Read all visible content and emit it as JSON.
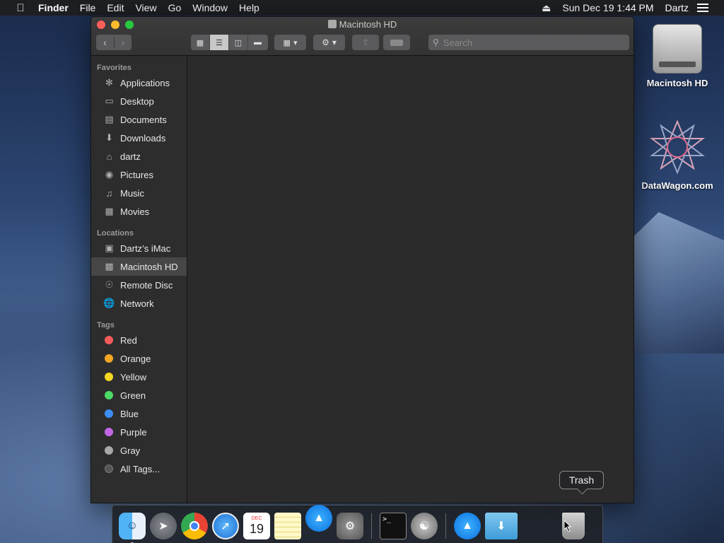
{
  "menubar": {
    "app_name": "Finder",
    "items": [
      "File",
      "Edit",
      "View",
      "Go",
      "Window",
      "Help"
    ],
    "eject_icon": "eject-icon",
    "clock": "Sun Dec 19  1:44 PM",
    "user": "Dartz"
  },
  "window": {
    "title": "Macintosh HD",
    "search_placeholder": "Search"
  },
  "sidebar": {
    "favorites_label": "Favorites",
    "favorites": [
      {
        "label": "Applications",
        "icon": "applications-icon"
      },
      {
        "label": "Desktop",
        "icon": "desktop-icon"
      },
      {
        "label": "Documents",
        "icon": "documents-icon"
      },
      {
        "label": "Downloads",
        "icon": "downloads-icon"
      },
      {
        "label": "dartz",
        "icon": "home-icon"
      },
      {
        "label": "Pictures",
        "icon": "pictures-icon"
      },
      {
        "label": "Music",
        "icon": "music-icon"
      },
      {
        "label": "Movies",
        "icon": "movies-icon"
      }
    ],
    "locations_label": "Locations",
    "locations": [
      {
        "label": "Dartz’s iMac",
        "icon": "imac-icon"
      },
      {
        "label": "Macintosh HD",
        "icon": "hard-disk-icon",
        "selected": true
      },
      {
        "label": "Remote Disc",
        "icon": "disc-icon"
      },
      {
        "label": "Network",
        "icon": "network-icon"
      }
    ],
    "tags_label": "Tags",
    "tags": [
      {
        "label": "Red",
        "color": "#f25b5b"
      },
      {
        "label": "Orange",
        "color": "#f5a623"
      },
      {
        "label": "Yellow",
        "color": "#f5d623"
      },
      {
        "label": "Green",
        "color": "#4cd964"
      },
      {
        "label": "Blue",
        "color": "#3b8ef5"
      },
      {
        "label": "Purple",
        "color": "#c465e6"
      },
      {
        "label": "Gray",
        "color": "#a8a8a8"
      },
      {
        "label": "All Tags...",
        "color": "#555555"
      }
    ]
  },
  "desktop": {
    "icons": [
      {
        "label": "Macintosh HD",
        "icon": "hard-disk-icon"
      },
      {
        "label": "DataWagon.com",
        "icon": "datawagon-icon"
      }
    ]
  },
  "dock": {
    "tooltip": "Trash",
    "apps": [
      "finder",
      "launchpad",
      "chrome",
      "safari",
      "calendar",
      "notes",
      "app-store-tilted",
      "system-preferences",
      "terminal",
      "automator",
      "app-store",
      "downloads-folder",
      "trash"
    ],
    "calendar_month": "DEC",
    "calendar_day": "19"
  }
}
